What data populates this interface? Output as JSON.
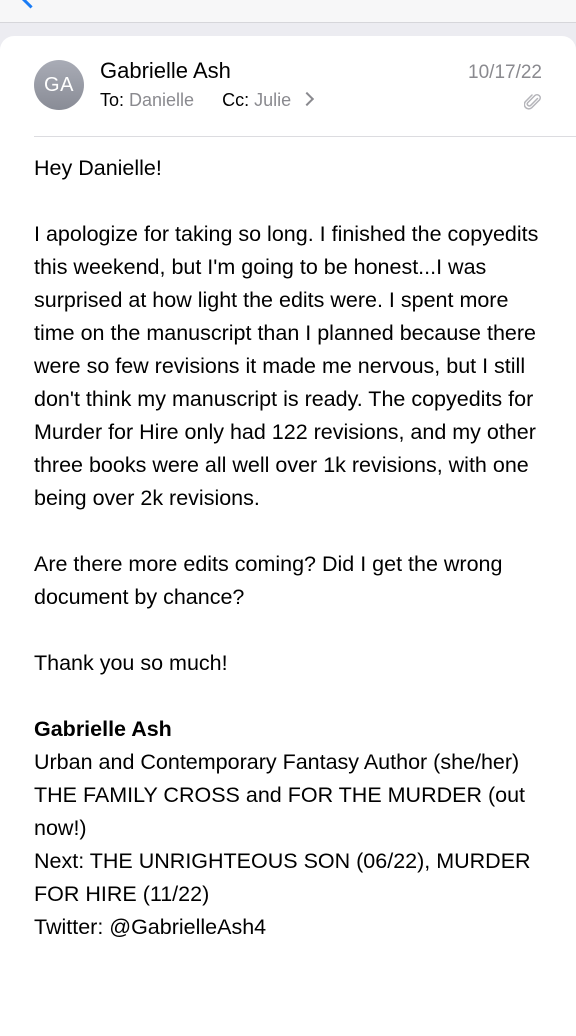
{
  "header": {
    "avatar_initials": "GA",
    "sender": "Gabrielle Ash",
    "to_label": "To:",
    "to_value": "Danielle",
    "cc_label": "Cc:",
    "cc_value": "Julie",
    "date": "10/17/22",
    "attachment_icon": "paperclip-icon"
  },
  "body": {
    "greeting": "Hey Danielle!",
    "paragraph1": "I apologize for taking so long. I finished the copyedits this weekend, but I'm going to be honest...I was surprised at how light the edits were. I spent more time on the manuscript than I planned because there were so few revisions it made me nervous, but I still don't think my manuscript is ready. The copyedits for Murder for Hire only had 122 revisions, and my other three books were all well over 1k revisions, with one being over 2k revisions.",
    "paragraph2": "Are there more edits coming? Did I get the wrong document by chance?",
    "closing": "Thank you so much!"
  },
  "signature": {
    "name": "Gabrielle Ash",
    "title": "Urban and Contemporary Fantasy Author (she/her)",
    "books": "THE FAMILY CROSS and FOR THE MURDER (out now!)",
    "next": "Next: THE UNRIGHTEOUS SON (06/22), MURDER FOR HIRE (11/22)",
    "twitter": "Twitter: @GabrielleAsh4"
  },
  "colors": {
    "accent": "#1a7cf5",
    "muted_text": "#8a8a8f",
    "avatar_bg": "#9a9da6",
    "page_bg": "#ececf1"
  }
}
